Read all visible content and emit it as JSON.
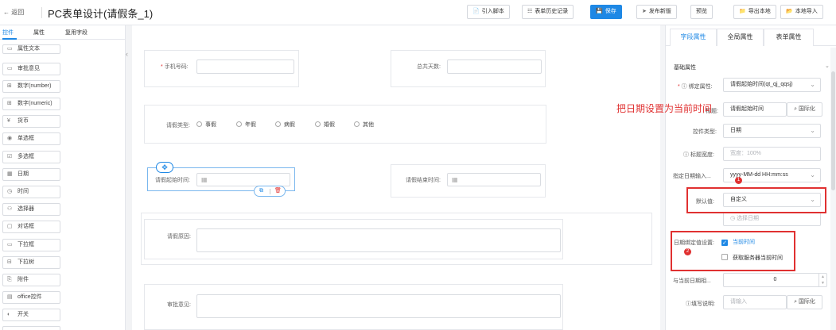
{
  "header": {
    "back_label": "← 返回",
    "title": "PC表单设计(请假条_1)",
    "buttons": [
      {
        "icon": "📄",
        "label": "引入脚本"
      },
      {
        "icon": "☷",
        "label": "表单历史记录"
      },
      {
        "icon": "💾",
        "label": "保存"
      },
      {
        "icon": "➤",
        "label": "发布新版"
      },
      {
        "icon": "",
        "label": "预览"
      },
      {
        "icon": "📁",
        "label": "导出本地"
      },
      {
        "icon": "📂",
        "label": "本地导入"
      }
    ]
  },
  "left_panel": {
    "tabs": [
      "控件",
      "属性",
      "复用字段"
    ],
    "items": [
      {
        "icon": "▭",
        "label": "属性文本"
      },
      {
        "icon": "▭",
        "label": "审批意见"
      },
      {
        "icon": "⊞",
        "label": "数字(number)"
      },
      {
        "icon": "⊞",
        "label": "数字(numeric)"
      },
      {
        "icon": "¥",
        "label": "货币"
      },
      {
        "icon": "◉",
        "label": "单选框"
      },
      {
        "icon": "☑",
        "label": "多选框"
      },
      {
        "icon": "▦",
        "label": "日期"
      },
      {
        "icon": "◷",
        "label": "时间"
      },
      {
        "icon": "⚇",
        "label": "选择器"
      },
      {
        "icon": "▢",
        "label": "对话框"
      },
      {
        "icon": "▭",
        "label": "下拉框"
      },
      {
        "icon": "⊟",
        "label": "下拉树"
      },
      {
        "icon": "⎘",
        "label": "附件"
      },
      {
        "icon": "▤",
        "label": "office控件"
      },
      {
        "icon": "◐",
        "label": "开关"
      }
    ]
  },
  "form": {
    "phone_label": "手机号码:",
    "total_days_label": "总共天数:",
    "leave_type_label": "请假类型:",
    "leave_type_options": [
      "事假",
      "年假",
      "病假",
      "婚假",
      "其他"
    ],
    "start_time_label": "请假起始时间:",
    "end_time_label": "请假结束时间:",
    "reason_label": "请假原因:",
    "approval_label": "审批意见:"
  },
  "right_panel": {
    "tabs": [
      "字段属性",
      "全局属性",
      "表单属性"
    ],
    "section_title": "基础属性",
    "rows": {
      "bind_attr_label": "绑定属性:",
      "bind_attr_value": "请假起始时间(qt_qj_qqsj)",
      "title_label": "标题:",
      "title_value": "请假起始时间",
      "i18n_button": "国际化",
      "control_type_label": "控件类型:",
      "control_type_value": "日期",
      "title_width_label": "标题宽度:",
      "title_width_placeholder": "宽度：100%",
      "date_format_label": "指定日期输入...",
      "date_format_value": "yyyy-MM-dd HH:mm:ss",
      "default_value_label": "默认值:",
      "default_value_value": "自定义",
      "date_picker_placeholder": "选择日期",
      "date_bind_label": "日期绑定值设置:",
      "current_time_label": "当前时间",
      "server_time_label": "获取服务器当前时间",
      "relative_label": "与当前日期相...",
      "relative_value": "0",
      "fill_desc_label": "填写说明:",
      "fill_desc_placeholder": "请输入",
      "fill_desc_i18n": "国际化"
    }
  },
  "annotation": {
    "note": "把日期设置为当前时间",
    "marker1": "1",
    "marker2": "2"
  },
  "colors": {
    "primary": "#1e88e5",
    "annotation_red": "#e03131"
  }
}
